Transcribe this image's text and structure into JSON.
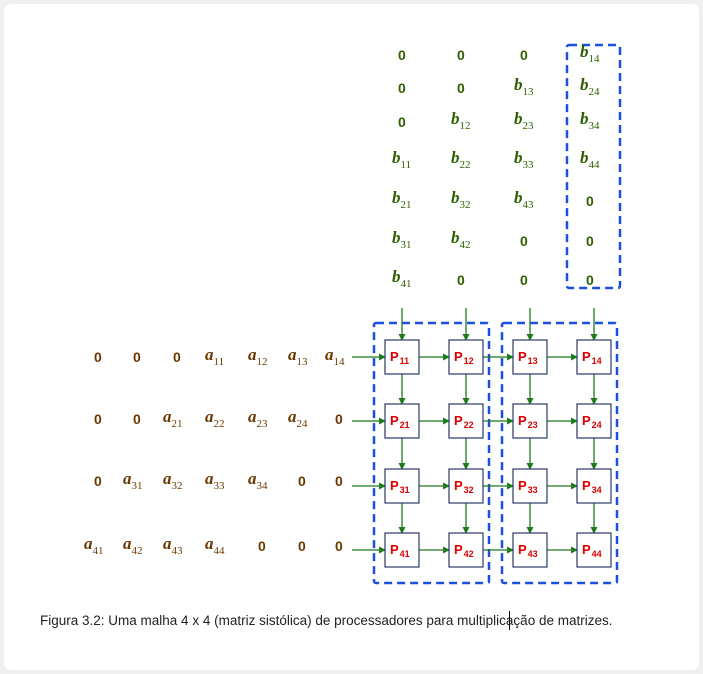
{
  "caption": "Figura 3.2: Uma malha 4 x 4 (matriz sistólica) de processadores para multiplicação de matrizes.",
  "colors": {
    "b_entries": "#2f6000",
    "a_entries": "#6b3700",
    "processor_label": "#dd0000",
    "arrows": "#1f7a1f",
    "dashed_boxes": "#1a4fe0",
    "processor_border": "#2a3a6a"
  },
  "b_columns": [
    [
      "0",
      "0",
      "0",
      "b|11",
      "b|21",
      "b|31",
      "b|41"
    ],
    [
      "0",
      "0",
      "b|12",
      "b|22",
      "b|32",
      "b|42",
      "0"
    ],
    [
      "0",
      "b|13",
      "b|23",
      "b|33",
      "b|43",
      "0",
      "0"
    ],
    [
      "b|14",
      "b|24",
      "b|34",
      "b|44",
      "0",
      "0",
      "0"
    ]
  ],
  "a_rows": [
    [
      "0",
      "0",
      "0",
      "a|11",
      "a|12",
      "a|13",
      "a|14"
    ],
    [
      "0",
      "0",
      "a|21",
      "a|22",
      "a|23",
      "a|24",
      "0"
    ],
    [
      "0",
      "a|31",
      "a|32",
      "a|33",
      "a|34",
      "0",
      "0"
    ],
    [
      "a|41",
      "a|42",
      "a|43",
      "a|44",
      "0",
      "0",
      "0"
    ]
  ],
  "processors": [
    [
      "P|11",
      "P|12",
      "P|13",
      "P|14"
    ],
    [
      "P|21",
      "P|22",
      "P|23",
      "P|24"
    ],
    [
      "P|31",
      "P|32",
      "P|33",
      "P|34"
    ],
    [
      "P|41",
      "P|42",
      "P|43",
      "P|44"
    ]
  ]
}
